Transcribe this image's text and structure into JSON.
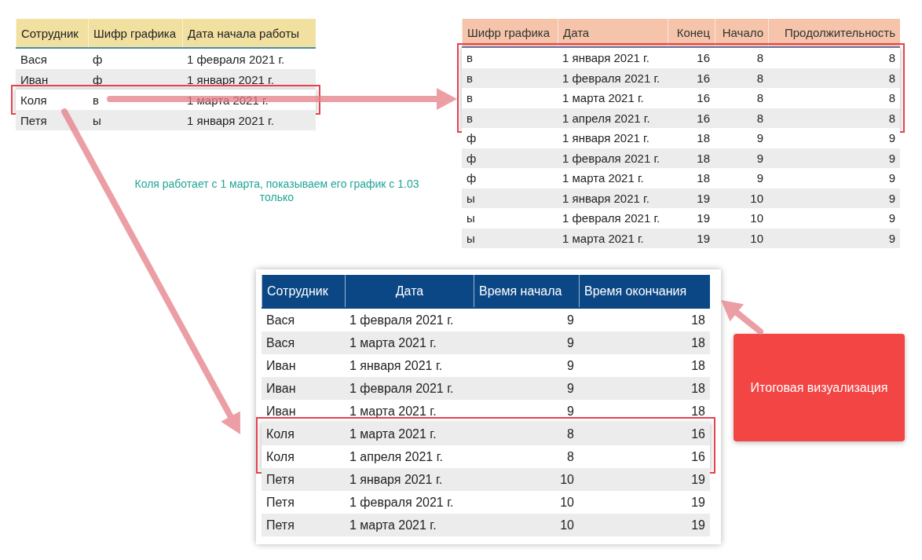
{
  "tables": [
    {
      "kind": "source",
      "columns": [
        {
          "label": "Сотрудник",
          "kind": "text"
        },
        {
          "label": "Шифр графика",
          "kind": "text"
        },
        {
          "label": "Дата начала работы",
          "kind": "text"
        }
      ],
      "rows": [
        {
          "cells": [
            "Вася",
            "ф",
            "1 февраля 2021 г."
          ],
          "highlighted": false
        },
        {
          "cells": [
            "Иван",
            "ф",
            "1 января 2021 г."
          ],
          "highlighted": false
        },
        {
          "cells": [
            "Коля",
            "в",
            "1 марта 2021 г."
          ],
          "highlighted": true
        },
        {
          "cells": [
            "Петя",
            "ы",
            "1 января 2021 г."
          ],
          "highlighted": false
        }
      ]
    },
    {
      "kind": "schedule",
      "columns": [
        {
          "label": "Шифр графика",
          "kind": "text"
        },
        {
          "label": "Дата",
          "kind": "text"
        },
        {
          "label": "Конец",
          "kind": "number"
        },
        {
          "label": "Начало",
          "kind": "number"
        },
        {
          "label": "Продолжительность",
          "kind": "number"
        }
      ],
      "rows": [
        {
          "cells": [
            "в",
            "1 января 2021 г.",
            "16",
            "8",
            "8"
          ],
          "highlighted": true
        },
        {
          "cells": [
            "в",
            "1 февраля 2021 г.",
            "16",
            "8",
            "8"
          ],
          "highlighted": true
        },
        {
          "cells": [
            "в",
            "1 марта 2021 г.",
            "16",
            "8",
            "8"
          ],
          "highlighted": true
        },
        {
          "cells": [
            "в",
            "1 апреля 2021 г.",
            "16",
            "8",
            "8"
          ],
          "highlighted": true
        },
        {
          "cells": [
            "ф",
            "1 января 2021 г.",
            "18",
            "9",
            "9"
          ],
          "highlighted": false
        },
        {
          "cells": [
            "ф",
            "1 февраля 2021 г.",
            "18",
            "9",
            "9"
          ],
          "highlighted": false
        },
        {
          "cells": [
            "ф",
            "1 марта 2021 г.",
            "18",
            "9",
            "9"
          ],
          "highlighted": false
        },
        {
          "cells": [
            "ы",
            "1 января 2021 г.",
            "19",
            "10",
            "9"
          ],
          "highlighted": false
        },
        {
          "cells": [
            "ы",
            "1 февраля 2021 г.",
            "19",
            "10",
            "9"
          ],
          "highlighted": false
        },
        {
          "cells": [
            "ы",
            "1 марта 2021 г.",
            "19",
            "10",
            "9"
          ],
          "highlighted": false
        }
      ]
    },
    {
      "kind": "result",
      "columns": [
        {
          "label": "Сотрудник",
          "kind": "text"
        },
        {
          "label": "Дата",
          "kind": "center"
        },
        {
          "label": "Время начала",
          "kind": "number"
        },
        {
          "label": "Время окончания",
          "kind": "number"
        }
      ],
      "rows": [
        {
          "cells": [
            "Вася",
            "1 февраля 2021 г.",
            "9",
            "18"
          ],
          "highlighted": false
        },
        {
          "cells": [
            "Вася",
            "1 марта 2021 г.",
            "9",
            "18"
          ],
          "highlighted": false
        },
        {
          "cells": [
            "Иван",
            "1 января 2021 г.",
            "9",
            "18"
          ],
          "highlighted": false
        },
        {
          "cells": [
            "Иван",
            "1 февраля 2021 г.",
            "9",
            "18"
          ],
          "highlighted": false
        },
        {
          "cells": [
            "Иван",
            "1 марта 2021 г.",
            "9",
            "18"
          ],
          "highlighted": false
        },
        {
          "cells": [
            "Коля",
            "1 марта 2021 г.",
            "8",
            "16"
          ],
          "highlighted": true
        },
        {
          "cells": [
            "Коля",
            "1 апреля 2021 г.",
            "8",
            "16"
          ],
          "highlighted": true
        },
        {
          "cells": [
            "Петя",
            "1 января 2021 г.",
            "10",
            "19"
          ],
          "highlighted": false
        },
        {
          "cells": [
            "Петя",
            "1 февраля 2021 г.",
            "10",
            "19"
          ],
          "highlighted": false
        },
        {
          "cells": [
            "Петя",
            "1 марта 2021 г.",
            "10",
            "19"
          ],
          "highlighted": false
        }
      ]
    }
  ],
  "note": "Коля работает с 1 марта, показываем его график с 1.03 только",
  "callout": "Итоговая визуализация"
}
